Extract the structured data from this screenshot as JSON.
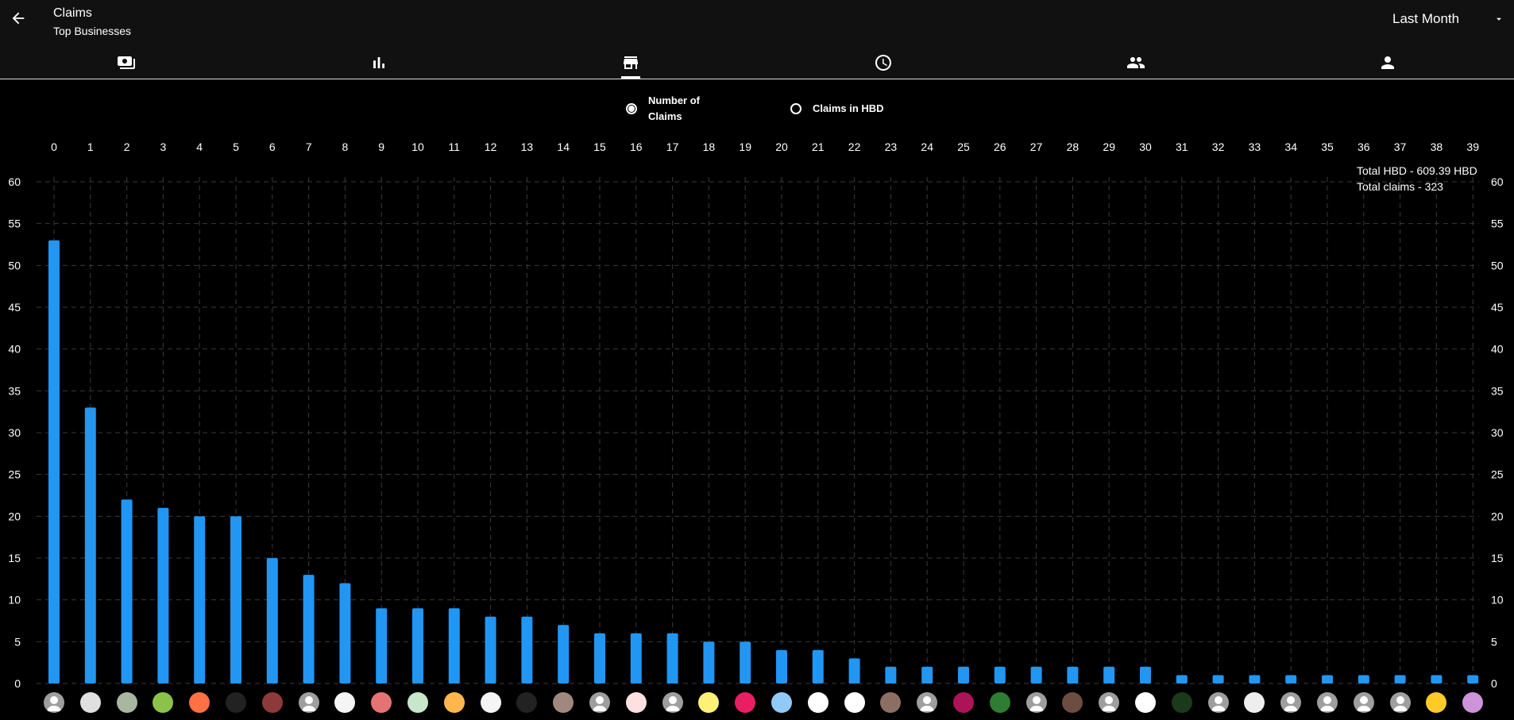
{
  "header": {
    "title": "Claims",
    "subtitle": "Top Businesses",
    "period": "Last Month"
  },
  "tabs": [
    {
      "name": "tab-payments",
      "icon": "payments-icon",
      "active": false
    },
    {
      "name": "tab-stats",
      "icon": "bar-chart-icon",
      "active": false
    },
    {
      "name": "tab-businesses",
      "icon": "store-icon",
      "active": true
    },
    {
      "name": "tab-history",
      "icon": "clock-icon",
      "active": false
    },
    {
      "name": "tab-users",
      "icon": "group-icon",
      "active": false
    },
    {
      "name": "tab-profile",
      "icon": "person-icon",
      "active": false
    }
  ],
  "radios": {
    "number_of_claims": {
      "line1": "Number of",
      "line2": "Claims",
      "selected": true
    },
    "claims_in_hbd": {
      "label": "Claims in HBD",
      "selected": false
    }
  },
  "totals": {
    "hbd": "Total HBD - 609.39 HBD",
    "claims": "Total claims - 323"
  },
  "colors": {
    "bar": "#2196f3",
    "background": "#000000",
    "appbar": "#111111",
    "grid": "#3a3a3a"
  },
  "chart_data": {
    "type": "bar",
    "categories": [
      "0",
      "1",
      "2",
      "3",
      "4",
      "5",
      "6",
      "7",
      "8",
      "9",
      "10",
      "11",
      "12",
      "13",
      "14",
      "15",
      "16",
      "17",
      "18",
      "19",
      "20",
      "21",
      "22",
      "23",
      "24",
      "25",
      "26",
      "27",
      "28",
      "29",
      "30",
      "31",
      "32",
      "33",
      "34",
      "35",
      "36",
      "37",
      "38",
      "39"
    ],
    "values": [
      53,
      33,
      22,
      21,
      20,
      20,
      15,
      13,
      12,
      9,
      9,
      9,
      8,
      8,
      7,
      6,
      6,
      6,
      5,
      5,
      4,
      4,
      3,
      2,
      2,
      2,
      2,
      2,
      2,
      2,
      2,
      1,
      1,
      1,
      1,
      1,
      1,
      1,
      1,
      1
    ],
    "ylim": [
      0,
      60
    ],
    "yticks": [
      0,
      5,
      10,
      15,
      20,
      25,
      30,
      35,
      40,
      45,
      50,
      55,
      60
    ],
    "grid": true,
    "axes": "left-and-right"
  },
  "avatars": [
    {
      "icon": "person-placeholder-icon",
      "color": "#9e9e9e"
    },
    {
      "icon": "logo-icon",
      "color": "#e0e0e0"
    },
    {
      "icon": "landscape-icon",
      "color": "#a8b8a0"
    },
    {
      "icon": "logo-icon",
      "color": "#8bc34a"
    },
    {
      "icon": "logo-icon",
      "color": "#ff7043"
    },
    {
      "icon": "blank-icon",
      "color": "#222222"
    },
    {
      "icon": "logo-icon",
      "color": "#8d3a3a"
    },
    {
      "icon": "person-placeholder-icon",
      "color": "#9e9e9e"
    },
    {
      "icon": "logo-icon",
      "color": "#f5f5f5"
    },
    {
      "icon": "logo-icon",
      "color": "#e57373"
    },
    {
      "icon": "logo-icon",
      "color": "#c8e6c9"
    },
    {
      "icon": "logo-icon",
      "color": "#ffb74d"
    },
    {
      "icon": "logo-icon",
      "color": "#f5f5f5"
    },
    {
      "icon": "blank-icon",
      "color": "#222222"
    },
    {
      "icon": "photo-icon",
      "color": "#a1887f"
    },
    {
      "icon": "person-placeholder-icon",
      "color": "#9e9e9e"
    },
    {
      "icon": "logo-icon",
      "color": "#ffe0e0"
    },
    {
      "icon": "person-placeholder-icon",
      "color": "#9e9e9e"
    },
    {
      "icon": "logo-icon",
      "color": "#fff176"
    },
    {
      "icon": "logo-icon",
      "color": "#e91e63"
    },
    {
      "icon": "logo-icon",
      "color": "#90caf9"
    },
    {
      "icon": "logo-icon",
      "color": "#ffffff"
    },
    {
      "icon": "logo-icon",
      "color": "#ffffff"
    },
    {
      "icon": "logo-icon",
      "color": "#8d6e63"
    },
    {
      "icon": "person-placeholder-icon",
      "color": "#9e9e9e"
    },
    {
      "icon": "logo-icon",
      "color": "#ad1457"
    },
    {
      "icon": "logo-icon",
      "color": "#2e7d32"
    },
    {
      "icon": "person-placeholder-icon",
      "color": "#9e9e9e"
    },
    {
      "icon": "logo-icon",
      "color": "#6d4c41"
    },
    {
      "icon": "person-placeholder-icon",
      "color": "#9e9e9e"
    },
    {
      "icon": "logo-icon",
      "color": "#ffffff"
    },
    {
      "icon": "logo-icon",
      "color": "#1b3a1b"
    },
    {
      "icon": "person-placeholder-icon",
      "color": "#9e9e9e"
    },
    {
      "icon": "logo-icon",
      "color": "#eeeeee"
    },
    {
      "icon": "person-placeholder-icon",
      "color": "#9e9e9e"
    },
    {
      "icon": "person-placeholder-icon",
      "color": "#9e9e9e"
    },
    {
      "icon": "person-placeholder-icon",
      "color": "#9e9e9e"
    },
    {
      "icon": "person-placeholder-icon",
      "color": "#9e9e9e"
    },
    {
      "icon": "logo-icon",
      "color": "#ffca28"
    },
    {
      "icon": "logo-icon",
      "color": "#ce93d8"
    }
  ]
}
